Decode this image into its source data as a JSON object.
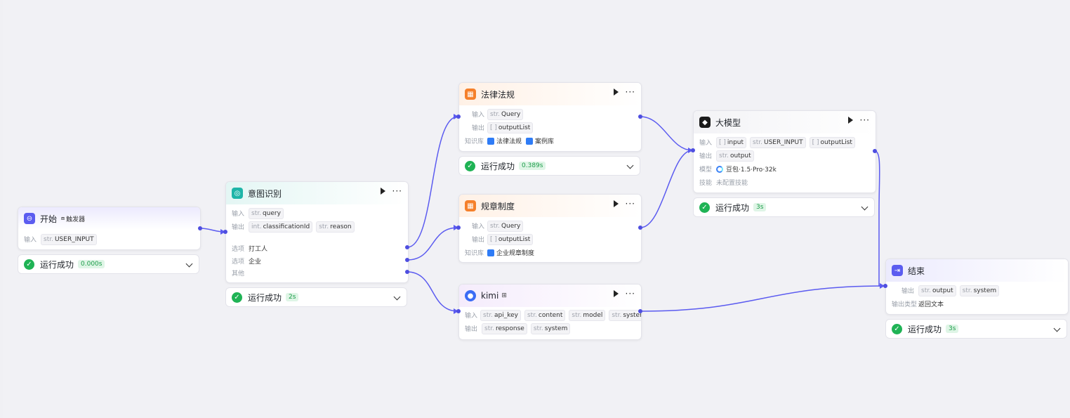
{
  "nodes": {
    "start": {
      "title": "开始",
      "trigger": "触发器",
      "input_label": "输入",
      "inputs": [
        {
          "type": "str.",
          "name": "USER_INPUT"
        }
      ],
      "status": {
        "text": "运行成功",
        "time": "0.000s"
      }
    },
    "intent": {
      "title": "意图识别",
      "input_label": "输入",
      "output_label": "输出",
      "inputs": [
        {
          "type": "str.",
          "name": "query"
        }
      ],
      "outputs": [
        {
          "type": "int.",
          "name": "classificationId"
        },
        {
          "type": "str.",
          "name": "reason"
        }
      ],
      "options": [
        {
          "label": "选项",
          "value": "打工人"
        },
        {
          "label": "选项",
          "value": "企业"
        },
        {
          "label": "其他",
          "value": ""
        }
      ],
      "status": {
        "text": "运行成功",
        "time": "2s"
      }
    },
    "law": {
      "title": "法律法规",
      "input_label": "输入",
      "output_label": "输出",
      "kb_label": "知识库",
      "inputs": [
        {
          "type": "str.",
          "name": "Query"
        }
      ],
      "outputs": [
        {
          "type": "[ ]",
          "name": "outputList"
        }
      ],
      "kbs": [
        "法律法规",
        "案例库"
      ],
      "status": {
        "text": "运行成功",
        "time": "0.389s"
      }
    },
    "rules": {
      "title": "规章制度",
      "input_label": "输入",
      "output_label": "输出",
      "kb_label": "知识库",
      "inputs": [
        {
          "type": "str.",
          "name": "Query"
        }
      ],
      "outputs": [
        {
          "type": "[ ]",
          "name": "outputList"
        }
      ],
      "kbs": [
        "企业规章制度"
      ]
    },
    "kimi": {
      "title": "kimi",
      "input_label": "输入",
      "output_label": "输出",
      "inputs": [
        {
          "type": "str.",
          "name": "api_key"
        },
        {
          "type": "str.",
          "name": "content"
        },
        {
          "type": "str.",
          "name": "model"
        },
        {
          "type": "str.",
          "name": "system"
        }
      ],
      "outputs": [
        {
          "type": "str.",
          "name": "response"
        },
        {
          "type": "str.",
          "name": "system"
        }
      ]
    },
    "llm": {
      "title": "大模型",
      "input_label": "输入",
      "output_label": "输出",
      "model_label": "模型",
      "skill_label": "技能",
      "inputs": [
        {
          "type": "[ ]",
          "name": "input"
        },
        {
          "type": "str.",
          "name": "USER_INPUT"
        },
        {
          "type": "[ ]",
          "name": "outputList"
        }
      ],
      "outputs": [
        {
          "type": "str.",
          "name": "output"
        }
      ],
      "model": "豆包·1.5·Pro·32k",
      "skill": "未配置技能",
      "status": {
        "text": "运行成功",
        "time": "3s"
      }
    },
    "end": {
      "title": "结束",
      "output_label": "输出",
      "output_type_label": "输出类型",
      "outputs": [
        {
          "type": "str.",
          "name": "output"
        },
        {
          "type": "str.",
          "name": "system"
        }
      ],
      "output_type": "返回文本",
      "status": {
        "text": "运行成功",
        "time": "3s"
      }
    }
  },
  "colors": {
    "edge": "#5b5bf0",
    "success": "#1fb355",
    "accent_purple": "#5b5cf0",
    "accent_orange": "#f5802b",
    "accent_teal": "#1fb5a8"
  }
}
